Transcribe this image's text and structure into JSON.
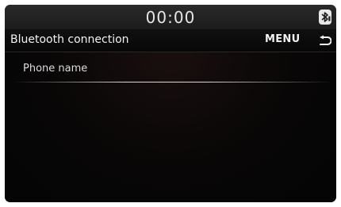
{
  "status_bar": {
    "time": "00:00",
    "bluetooth_icon": "bluetooth-status-icon"
  },
  "header": {
    "title": "Bluetooth connection",
    "menu_label": "MENU",
    "back_icon": "back-arrow-icon"
  },
  "list": {
    "items": [
      {
        "label": "Phone name"
      }
    ]
  },
  "colors": {
    "background": "#050505",
    "text": "#f2f2f2",
    "accent_divider": "#4a1a1a"
  }
}
